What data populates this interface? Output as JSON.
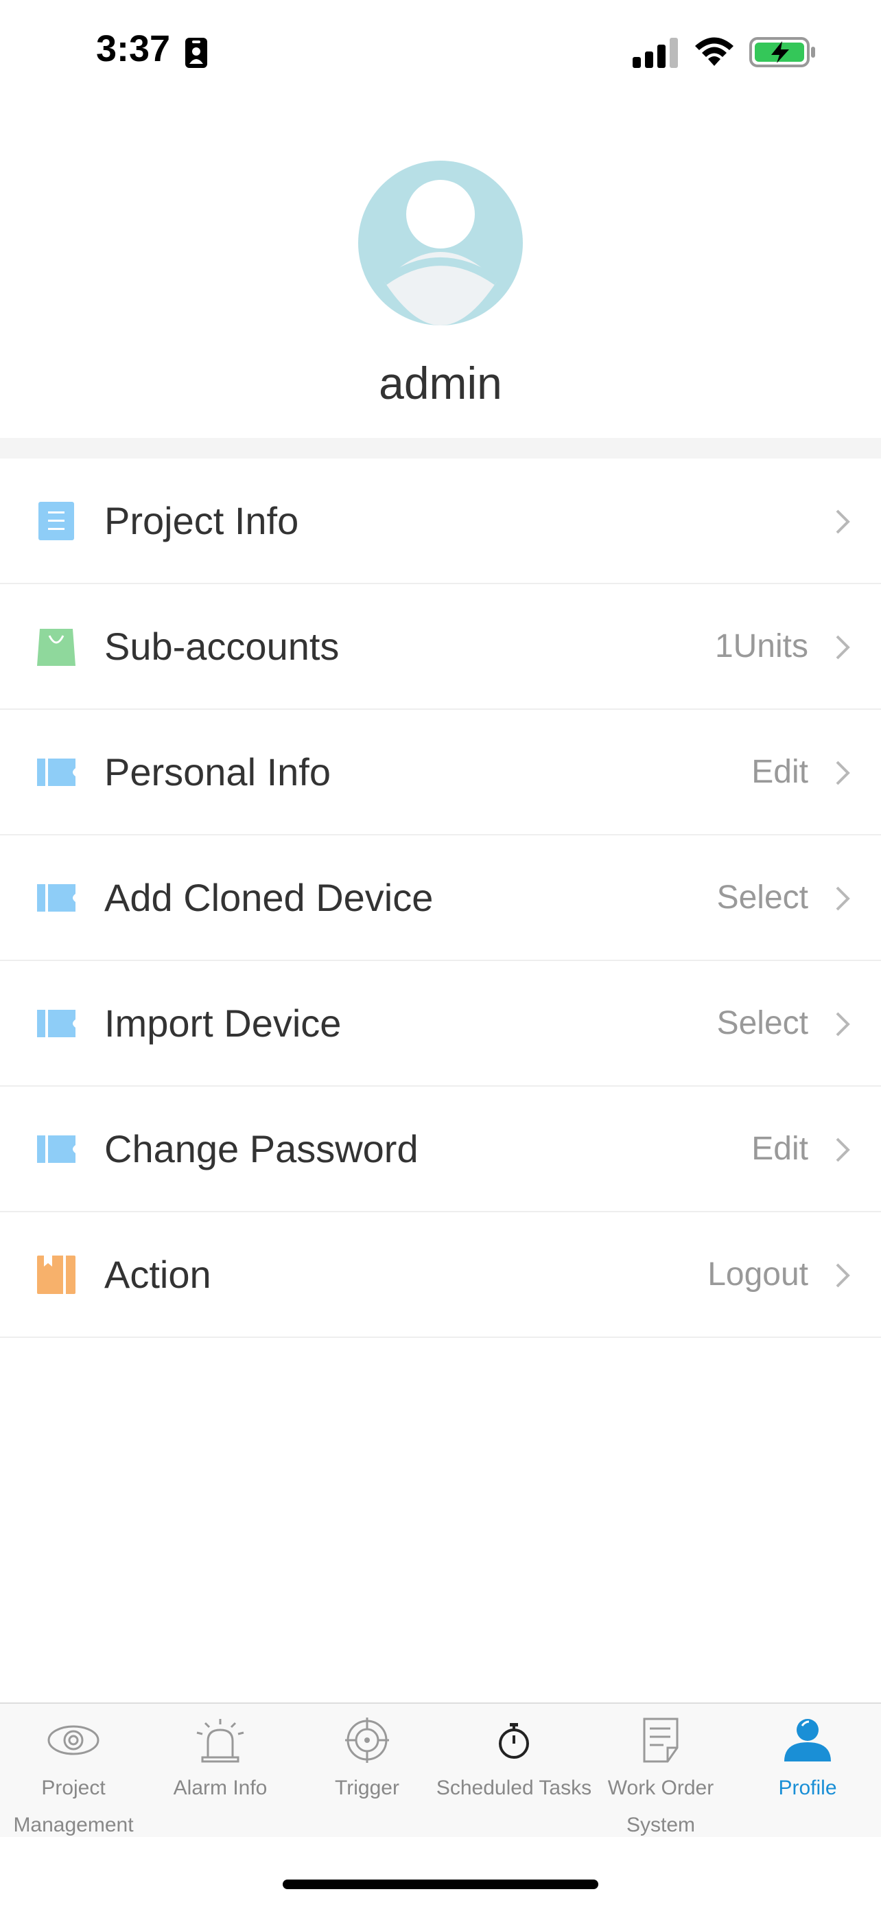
{
  "status_bar": {
    "time": "3:37",
    "icons": [
      "contact-badge-icon",
      "signal-icon",
      "wifi-icon",
      "battery-charging-icon"
    ]
  },
  "profile": {
    "username": "admin",
    "avatar_icon": "user-avatar-icon"
  },
  "menu": [
    {
      "label": "Project Info",
      "value": "",
      "icon": "document-icon",
      "color": "#8ecdf7"
    },
    {
      "label": "Sub-accounts",
      "value": "1Units",
      "icon": "shopping-bag-icon",
      "color": "#8fd89c"
    },
    {
      "label": "Personal Info",
      "value": "Edit",
      "icon": "ticket-icon",
      "color": "#8ecdf7"
    },
    {
      "label": "Add Cloned Device",
      "value": "Select",
      "icon": "ticket-icon",
      "color": "#8ecdf7"
    },
    {
      "label": "Import Device",
      "value": "Select",
      "icon": "ticket-icon",
      "color": "#8ecdf7"
    },
    {
      "label": "Change Password",
      "value": "Edit",
      "icon": "ticket-icon",
      "color": "#8ecdf7"
    },
    {
      "label": "Action",
      "value": "Logout",
      "icon": "bookmark-book-icon",
      "color": "#f7b16b"
    }
  ],
  "tabbar": {
    "active_color": "#1a8fd6",
    "tabs": [
      {
        "label": "Project Management",
        "icon": "eye-icon",
        "active": false
      },
      {
        "label": "Alarm Info",
        "icon": "alarm-siren-icon",
        "active": false
      },
      {
        "label": "Trigger",
        "icon": "target-icon",
        "active": false
      },
      {
        "label": "Scheduled Tasks",
        "icon": "stopwatch-icon",
        "active": false
      },
      {
        "label": "Work Order System",
        "icon": "edit-document-icon",
        "active": false
      },
      {
        "label": "Profile",
        "icon": "person-icon",
        "active": true
      }
    ]
  }
}
